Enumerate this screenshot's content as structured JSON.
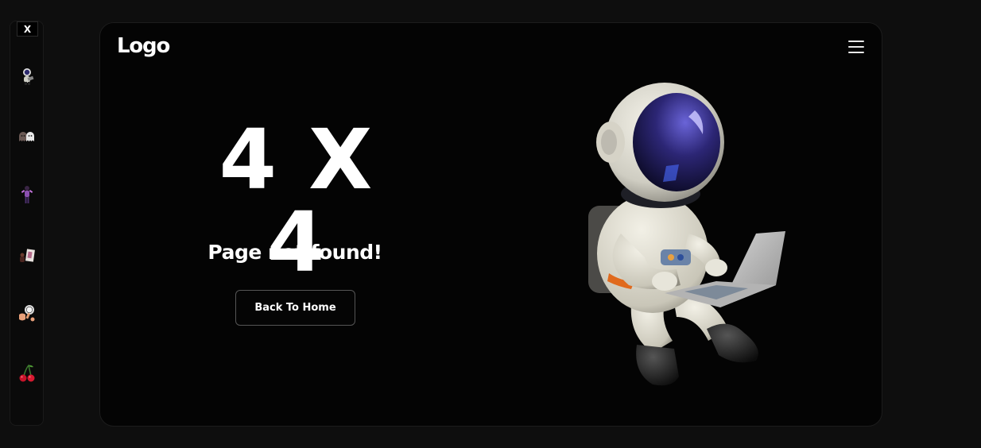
{
  "sidebar": {
    "close_label": "X",
    "thumbnails": [
      {
        "icon": "astronaut-thumb-icon"
      },
      {
        "icon": "ghosts-thumb-icon"
      },
      {
        "icon": "character-thumb-icon"
      },
      {
        "icon": "figure-card-thumb-icon"
      },
      {
        "icon": "hand-magnifier-thumb-icon"
      },
      {
        "icon": "cherry-thumb-icon"
      }
    ]
  },
  "header": {
    "logo": "Logo",
    "menu_icon": "hamburger-menu-icon"
  },
  "main": {
    "headline": "4 X 4",
    "subtitle": "Page not found!",
    "back_button_label": "Back To Home",
    "illustration": "astronaut-with-laptop"
  },
  "colors": {
    "page_bg": "#0e0e0e",
    "card_bg": "#040404",
    "text": "#ffffff",
    "button_border": "#555555"
  }
}
